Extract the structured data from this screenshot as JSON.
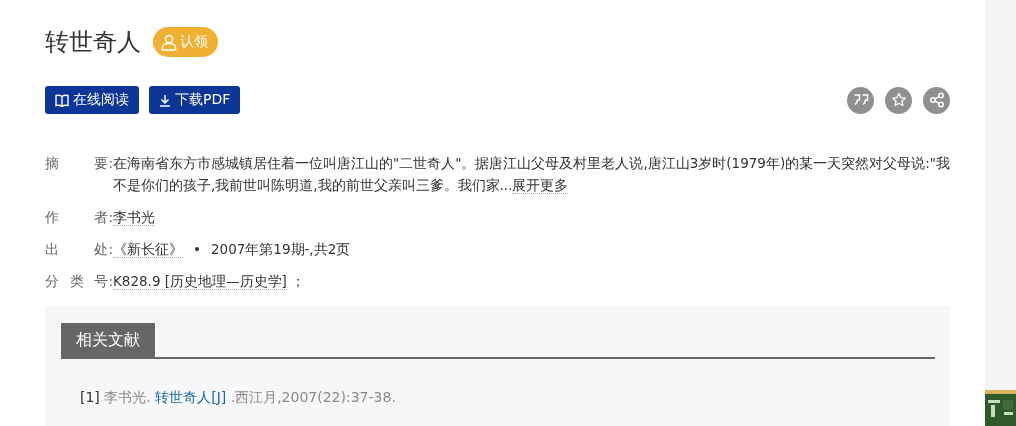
{
  "title": "转世奇人",
  "claim_badge": {
    "label": "认领"
  },
  "buttons": [
    {
      "kind": "read",
      "label": "在线阅读"
    },
    {
      "kind": "download",
      "label": "下载PDF"
    }
  ],
  "actions": [
    {
      "kind": "quote"
    },
    {
      "kind": "favorite"
    },
    {
      "kind": "share"
    }
  ],
  "meta": [
    {
      "kind": "abstract",
      "label_parts": [
        "摘",
        "要:"
      ],
      "text": "在海南省东方市感城镇居住着一位叫唐江山的\"二世奇人\"。据唐江山父母及村里老人说,唐江山3岁时(1979年)的某一天突然对父母说:\"我不是你们的孩子,我前世叫陈明道,我的前世父亲叫三爹。我们家...",
      "more": "展开更多"
    },
    {
      "kind": "author",
      "label_parts": [
        "作",
        "者:"
      ],
      "link": "李书光"
    },
    {
      "kind": "source",
      "label_parts": [
        "出",
        "处:"
      ],
      "link": "《新长征》",
      "separator": "•",
      "text": "2007年第19期-,共2页"
    },
    {
      "kind": "classification",
      "label_parts": [
        "分",
        "类",
        "号:"
      ],
      "link": "K828.9 [历史地理—历史学]",
      "text": "；"
    }
  ],
  "related": {
    "heading": "相关文献",
    "references": [
      {
        "index": "[1]",
        "authors": "李书光.",
        "title": "转世奇人[J]",
        "rest": ".西江月,2007(22):37-38."
      }
    ]
  }
}
